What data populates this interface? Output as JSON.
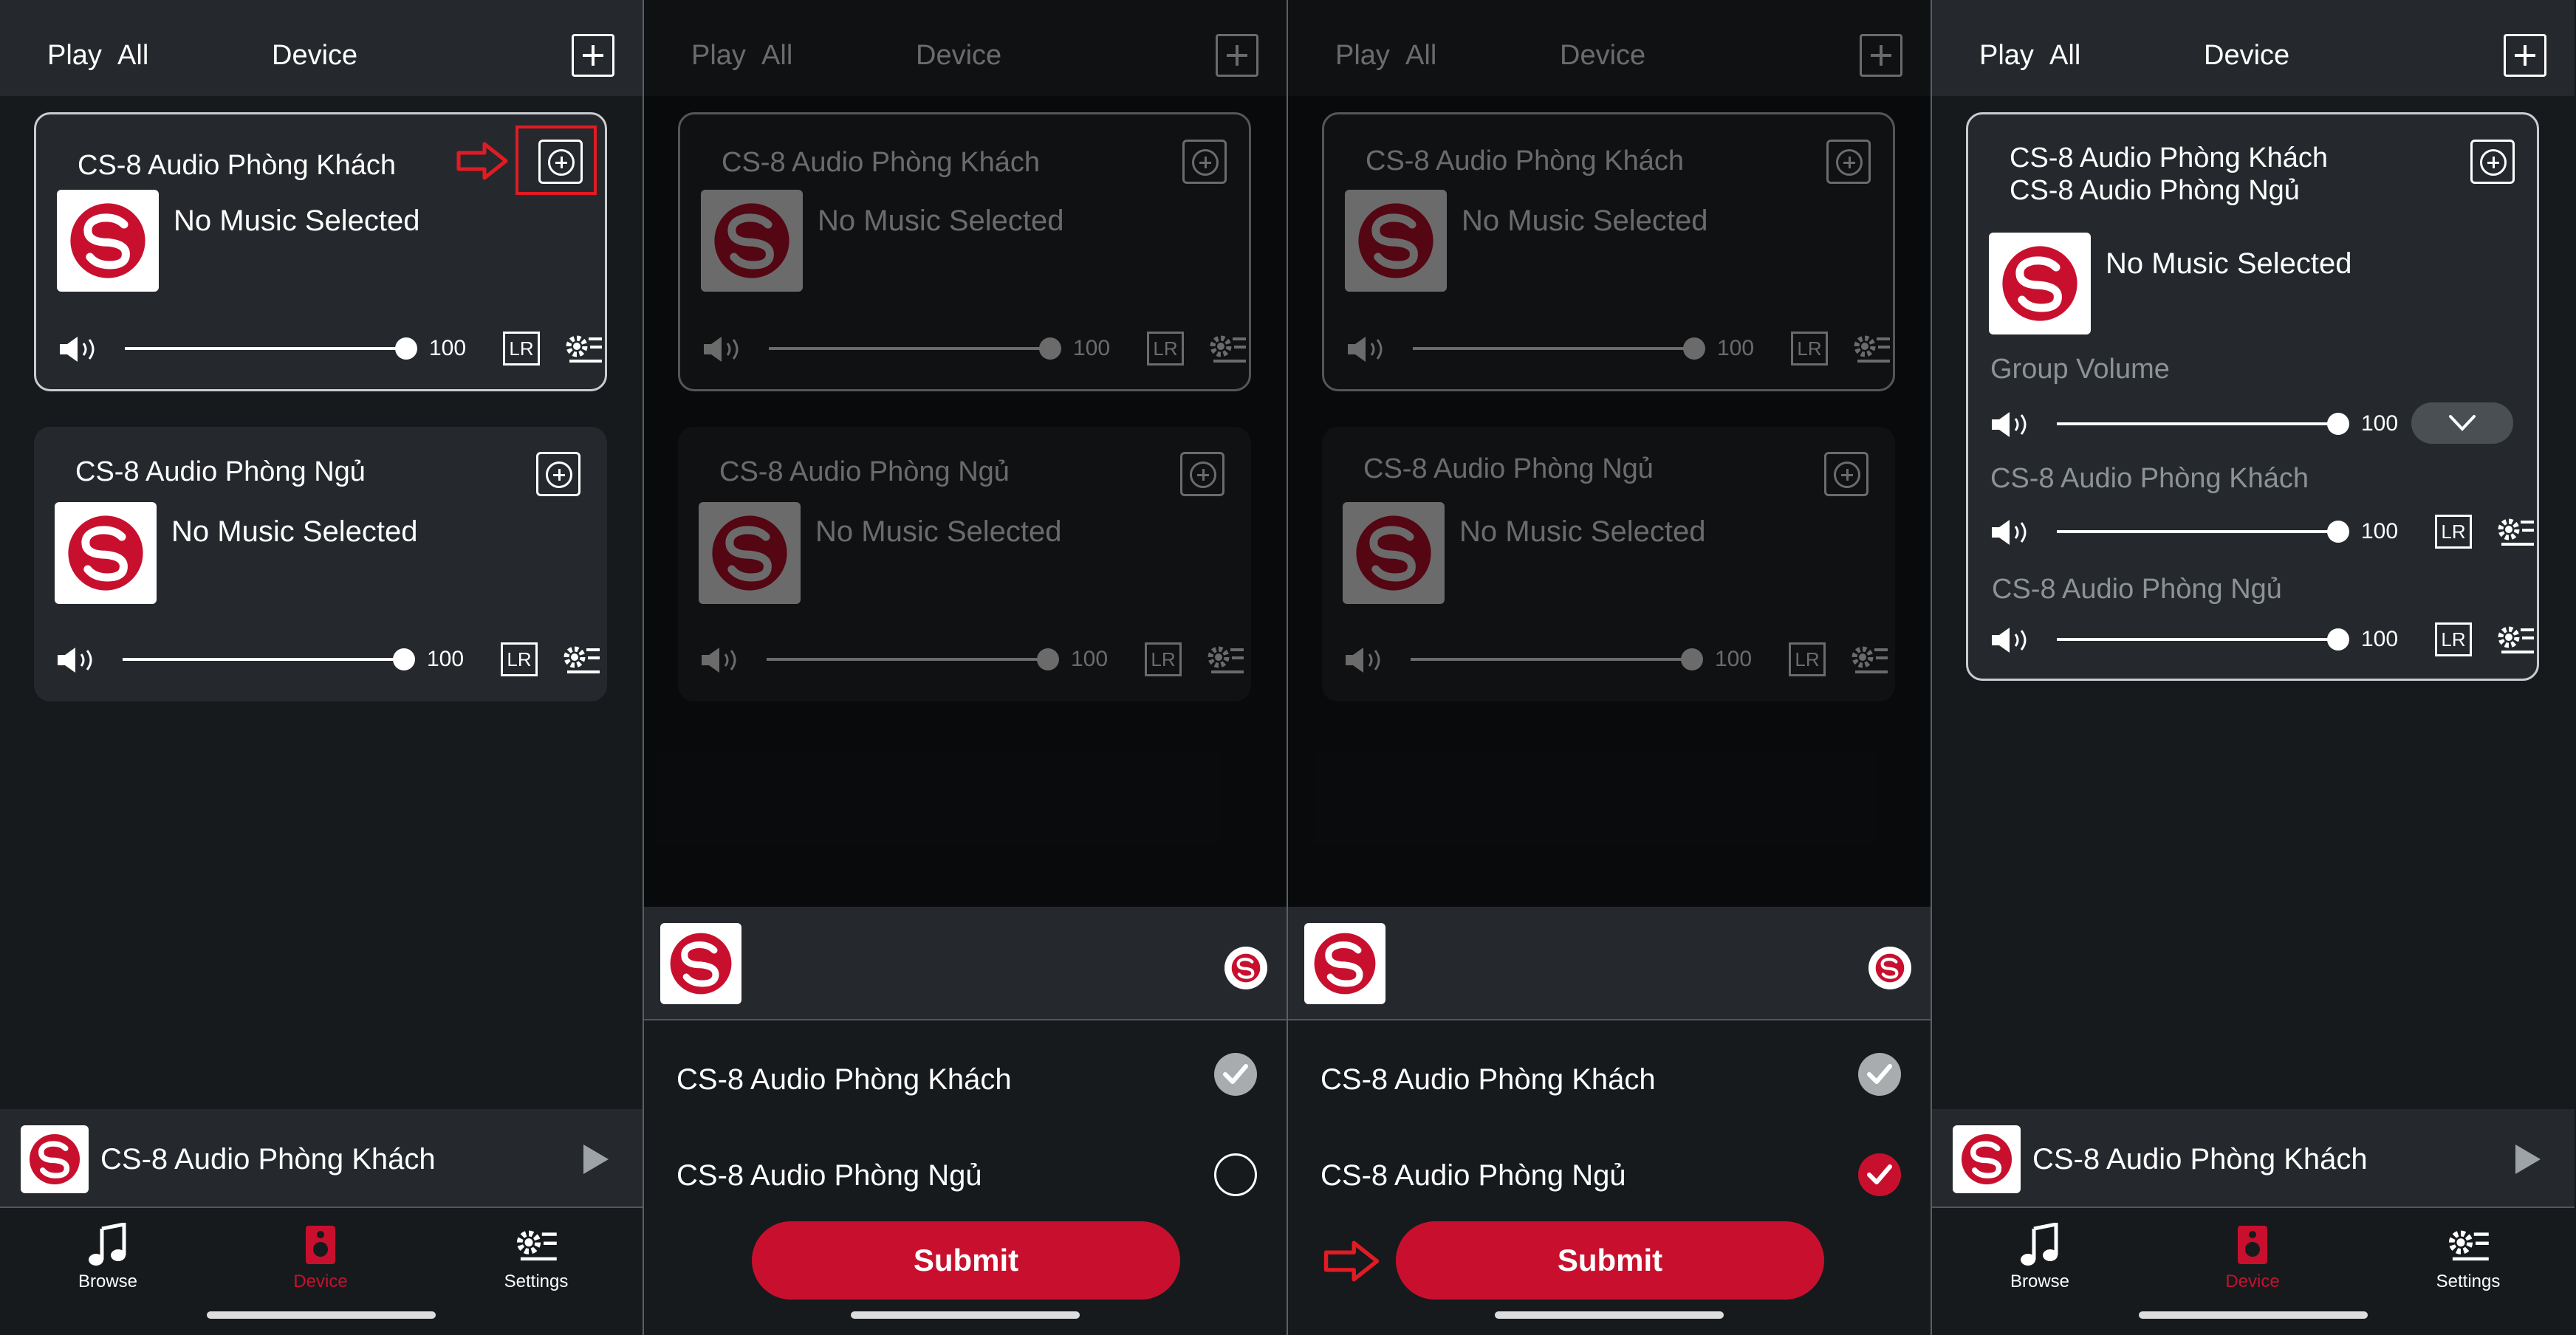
{
  "header": {
    "play": "Play",
    "all": "All",
    "device": "Device"
  },
  "devices": [
    {
      "title": "CS-8 Audio Phòng Khách",
      "status": "No Music Selected",
      "volume": "100",
      "lr": "LR"
    },
    {
      "title": "CS-8 Audio Phòng Ngủ",
      "status": "No Music Selected",
      "volume": "100",
      "lr": "LR"
    }
  ],
  "group_card": {
    "title_line1": "CS-8 Audio Phòng Khách",
    "title_line2": "CS-8 Audio Phòng Ngủ",
    "status": "No Music Selected",
    "group_volume_label": "Group Volume",
    "group_volume": "100",
    "members": [
      {
        "name": "CS-8 Audio Phòng Khách",
        "volume": "100",
        "lr": "LR"
      },
      {
        "name": "CS-8 Audio Phòng Ngủ",
        "volume": "100",
        "lr": "LR"
      }
    ]
  },
  "player": {
    "title": "CS-8 Audio Phòng Khách"
  },
  "tabs": {
    "browse": "Browse",
    "device": "Device",
    "settings": "Settings"
  },
  "sheet": {
    "items": [
      "CS-8 Audio Phòng Khách",
      "CS-8 Audio Phòng Ngủ"
    ],
    "submit": "Submit"
  },
  "colors": {
    "accent": "#c8102e",
    "background": "#161a1d",
    "card": "#25292d",
    "highlight": "#e21b23"
  }
}
